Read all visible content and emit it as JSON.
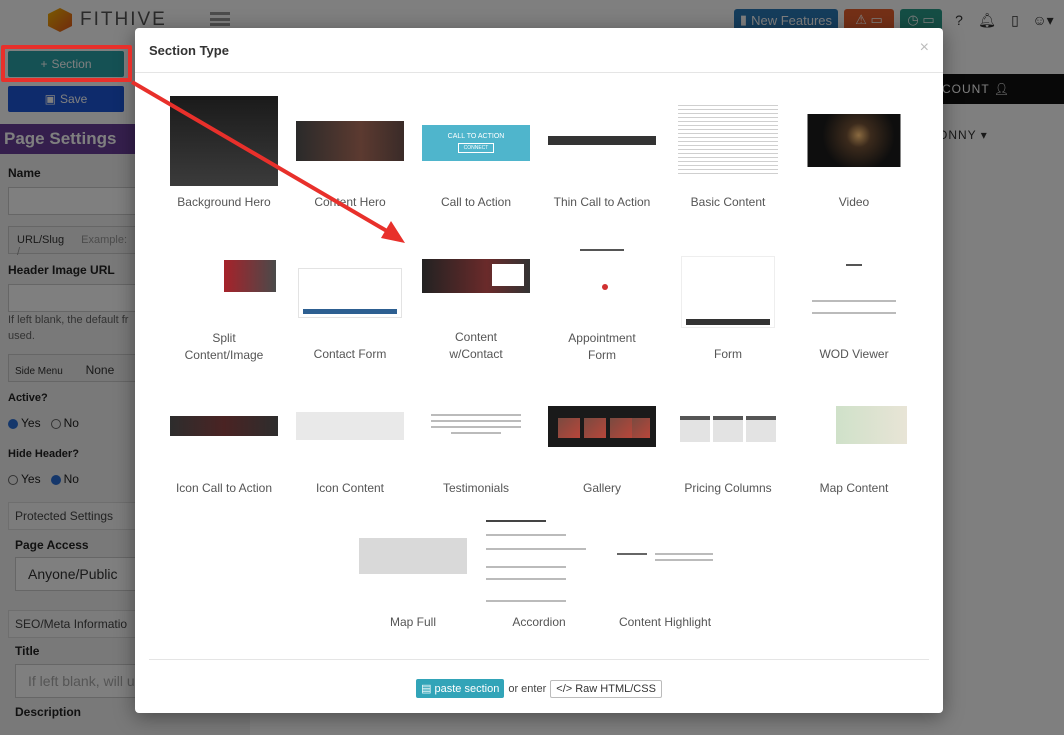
{
  "app": {
    "brand": "FITHIVE",
    "new_features": "New Features",
    "section_button": "Section",
    "save_button": "Save",
    "account_label": "COUNT",
    "user_name": "ONNY"
  },
  "sidebar": {
    "title": "Page Settings",
    "name_label": "Name",
    "url_slug": "URL/Slug",
    "url_placeholder": "Example: /",
    "header_image_label": "Header Image URL",
    "header_image_help": "If left blank, the default fr",
    "header_image_help2": "used.",
    "side_menu_label": "Side Menu",
    "side_menu_value": "None",
    "active_label": "Active?",
    "active_yes": "Yes",
    "active_no": "No",
    "hide_header_label": "Hide Header?",
    "hide_header_yes": "Yes",
    "hide_header_no": "No",
    "protected_settings": "Protected Settings",
    "page_access_label": "Page Access",
    "page_access_value": "Anyone/Public",
    "seo_label": "SEO/Meta Informatio",
    "title_label": "Title",
    "title_placeholder": "If left blank, will u",
    "description_label": "Description"
  },
  "modal": {
    "title": "Section Type",
    "close": "×",
    "tiles": [
      {
        "label": "Background Hero"
      },
      {
        "label": "Content Hero"
      },
      {
        "label": "Call to Action"
      },
      {
        "label": "Thin Call to Action"
      },
      {
        "label": "Basic Content"
      },
      {
        "label": "Video"
      },
      {
        "label": "Split Content/Image"
      },
      {
        "label": "Contact Form"
      },
      {
        "label": "Content w/Contact"
      },
      {
        "label": "Appointment Form"
      },
      {
        "label": "Form"
      },
      {
        "label": "WOD Viewer"
      },
      {
        "label": "Icon Call to Action"
      },
      {
        "label": "Icon Content"
      },
      {
        "label": "Testimonials"
      },
      {
        "label": "Gallery"
      },
      {
        "label": "Pricing Columns"
      },
      {
        "label": "Map Content"
      },
      {
        "label": "Map Full"
      },
      {
        "label": "Accordion"
      },
      {
        "label": "Content Highlight"
      }
    ],
    "cta_text": "CALL TO ACTION",
    "cta_button": "CONNECT",
    "footer": {
      "paste_label": "paste section",
      "or_enter": "or enter",
      "raw_label": "Raw HTML/CSS"
    }
  },
  "colors": {
    "accent_teal": "#2aa3a8",
    "save_blue": "#1d57d8",
    "annotation_red": "#e8302b",
    "settings_purple": "#6a3f9a"
  }
}
